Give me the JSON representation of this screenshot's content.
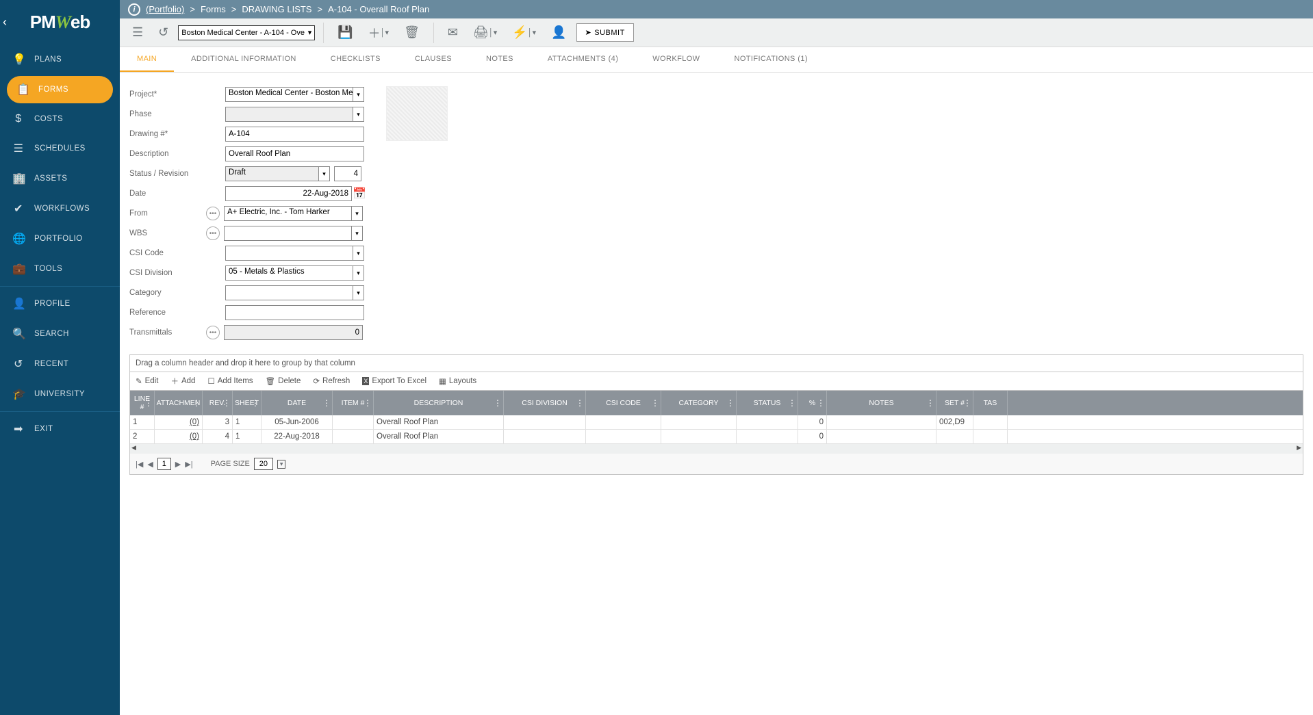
{
  "logo": "PMWeb",
  "breadcrumb": {
    "portfolio": "(Portfolio)",
    "sep": ">",
    "p2": "Forms",
    "p3": "DRAWING LISTS",
    "p4": "A-104 - Overall Roof Plan"
  },
  "toolbar": {
    "project_dd": "Boston Medical Center - A-104 - Ove",
    "submit": "SUBMIT"
  },
  "sidebar": {
    "items": [
      {
        "label": "PLANS",
        "icon": "lightbulb"
      },
      {
        "label": "FORMS",
        "icon": "clipboard",
        "active": true
      },
      {
        "label": "COSTS",
        "icon": "dollar"
      },
      {
        "label": "SCHEDULES",
        "icon": "bars"
      },
      {
        "label": "ASSETS",
        "icon": "building"
      },
      {
        "label": "WORKFLOWS",
        "icon": "check"
      },
      {
        "label": "PORTFOLIO",
        "icon": "globe"
      },
      {
        "label": "TOOLS",
        "icon": "briefcase"
      }
    ],
    "footer": [
      {
        "label": "PROFILE",
        "icon": "user"
      },
      {
        "label": "SEARCH",
        "icon": "search"
      },
      {
        "label": "RECENT",
        "icon": "history"
      },
      {
        "label": "UNIVERSITY",
        "icon": "grad"
      },
      {
        "label": "EXIT",
        "icon": "exit"
      }
    ]
  },
  "tabs": [
    {
      "label": "MAIN",
      "active": true
    },
    {
      "label": "ADDITIONAL INFORMATION"
    },
    {
      "label": "CHECKLISTS"
    },
    {
      "label": "CLAUSES"
    },
    {
      "label": "NOTES"
    },
    {
      "label": "ATTACHMENTS (4)"
    },
    {
      "label": "WORKFLOW"
    },
    {
      "label": "NOTIFICATIONS (1)"
    }
  ],
  "form": {
    "project_label": "Project*",
    "project_value": "Boston Medical Center - Boston Med",
    "phase_label": "Phase",
    "phase_value": "",
    "drawing_label": "Drawing #*",
    "drawing_value": "A-104",
    "desc_label": "Description",
    "desc_value": "Overall Roof Plan",
    "status_label": "Status / Revision",
    "status_value": "Draft",
    "revision_value": "4",
    "date_label": "Date",
    "date_value": "22-Aug-2018",
    "from_label": "From",
    "from_value": "A+ Electric, Inc. - Tom Harker",
    "wbs_label": "WBS",
    "wbs_value": "",
    "csicode_label": "CSI Code",
    "csicode_value": "",
    "csidiv_label": "CSI Division",
    "csidiv_value": "05 - Metals & Plastics",
    "category_label": "Category",
    "category_value": "",
    "reference_label": "Reference",
    "reference_value": "",
    "transmittals_label": "Transmittals",
    "transmittals_value": "0"
  },
  "grid": {
    "group_hint": "Drag a column header and drop it here to group by that column",
    "toolbar": {
      "edit": "Edit",
      "add": "Add",
      "add_items": "Add Items",
      "delete": "Delete",
      "refresh": "Refresh",
      "export": "Export To Excel",
      "layouts": "Layouts"
    },
    "headers": {
      "line": "LINE #",
      "att": "ATTACHMEN",
      "rev": "REV.",
      "sheet": "SHEET",
      "date": "DATE",
      "item": "ITEM #",
      "desc": "DESCRIPTION",
      "csid": "CSI DIVISION",
      "csic": "CSI CODE",
      "cat": "CATEGORY",
      "status": "STATUS",
      "pct": "%",
      "notes": "NOTES",
      "set": "SET #",
      "task": "TAS"
    },
    "rows": [
      {
        "line": "1",
        "att": "(0)",
        "rev": "3",
        "sheet": "1",
        "date": "05-Jun-2006",
        "item": "",
        "desc": "Overall Roof Plan",
        "csid": "",
        "csic": "",
        "cat": "",
        "status": "",
        "pct": "0",
        "notes": "",
        "set": "002,D9",
        "task": ""
      },
      {
        "line": "2",
        "att": "(0)",
        "rev": "4",
        "sheet": "1",
        "date": "22-Aug-2018",
        "item": "",
        "desc": "Overall Roof Plan",
        "csid": "",
        "csic": "",
        "cat": "",
        "status": "",
        "pct": "0",
        "notes": "",
        "set": "",
        "task": ""
      }
    ],
    "pager": {
      "page": "1",
      "size_label": "PAGE SIZE",
      "size": "20"
    }
  }
}
